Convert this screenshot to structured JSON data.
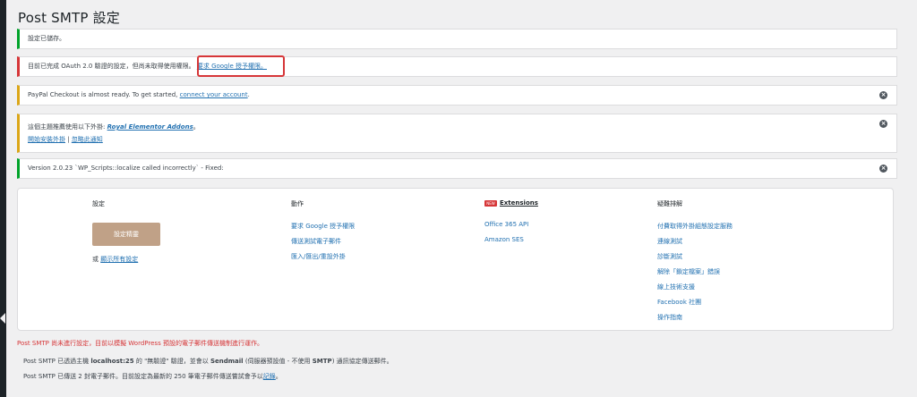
{
  "page": {
    "title": "Post SMTP 設定"
  },
  "notices": {
    "saved": {
      "text": "設定已儲存。"
    },
    "oauth": {
      "text": "目前已完成 OAuth 2.0 驗證的設定，但尚未取得使用權限。",
      "link": "要求 Google 授予權限。"
    },
    "paypal": {
      "text": "PayPal Checkout is almost ready. To get started, ",
      "link": "connect your account",
      "suffix": "."
    },
    "theme": {
      "text": "這個主題推薦使用以下外掛: ",
      "plugin": "Royal Elementor Addons",
      "plugin_suffix": "。",
      "install_link": "開始安裝外掛",
      "separator": " | ",
      "dismiss_link": "忽略此通知"
    },
    "version": {
      "text": "Version 2.0.23 `WP_Scripts::localize called incorrectly` - Fixed:"
    }
  },
  "panel": {
    "setup": {
      "heading": "設定",
      "button": "設定精靈",
      "or_text": "或 ",
      "show_all_link": "顯示所有設定"
    },
    "actions": {
      "heading": "動作",
      "items": [
        "要求 Google 授予權限",
        "傳送測試電子郵件",
        "匯入/匯出/重設外掛"
      ]
    },
    "extensions": {
      "badge": "NEW",
      "heading": "Extensions",
      "items": [
        "Office 365 API",
        "Amazon SES"
      ]
    },
    "help": {
      "heading": "疑難排解",
      "items": [
        "付費取得外掛組態設定服務",
        "連線測試",
        "診斷測試",
        "解除「鎖定檔案」錯誤",
        "線上技術支援",
        "Facebook 社團",
        "操作指南"
      ]
    }
  },
  "status": {
    "warning": "Post SMTP 尚未進行設定，目前以模擬 WordPress 預設的電子郵件傳送機制進行運作。",
    "line1_a": "Post SMTP 已透過主機 ",
    "line1_host": "localhost:25",
    "line1_b": " 的 \"無驗證\" 驗證，並會以 ",
    "line1_transport": "Sendmail",
    "line1_c": " (伺服器預設值 - 不使用 ",
    "line1_smtp": "SMTP",
    "line1_d": ") 通訊協定傳送郵件。",
    "line2_a": "Post SMTP 已傳送 2 封電子郵件。目前設定為最新的 250 筆電子郵件傳送嘗試會予以",
    "line2_link": "記錄",
    "line2_b": "。"
  },
  "colors": {
    "success": "#00a32a",
    "error": "#d63638",
    "warning": "#dba617",
    "link": "#2271b1",
    "setup_button": "#c0a187",
    "background": "#f0f0f1"
  }
}
